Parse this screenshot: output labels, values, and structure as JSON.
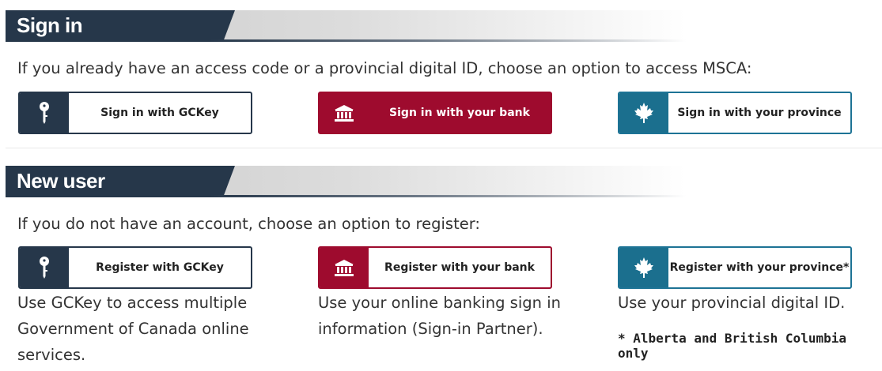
{
  "signin": {
    "heading": "Sign in",
    "lead": "If you already have an access code or a provincial digital ID, choose an option to access MSCA:",
    "buttons": {
      "gckey": "Sign in with GCKey",
      "bank": "Sign in with your bank",
      "province": "Sign in with your province"
    }
  },
  "newuser": {
    "heading": "New user",
    "lead": "If you do not have an account, choose an option to register:",
    "buttons": {
      "gckey": "Register with GCKey",
      "bank": "Register with your bank",
      "province": "Register with your province*"
    },
    "descriptions": {
      "gckey": "Use GCKey to access multiple Government of Canada online services.",
      "bank": "Use your online banking sign in information (Sign-in Partner).",
      "province": "Use your provincial digital ID."
    },
    "note": "* Alberta and British Columbia only"
  },
  "icons": {
    "gckey": "key-icon",
    "bank": "bank-icon",
    "province": "maple-leaf-icon"
  },
  "colors": {
    "header_dark": "#26374a",
    "gckey": "#26374a",
    "bank": "#9e0b2e",
    "province": "#1b6f8e"
  }
}
